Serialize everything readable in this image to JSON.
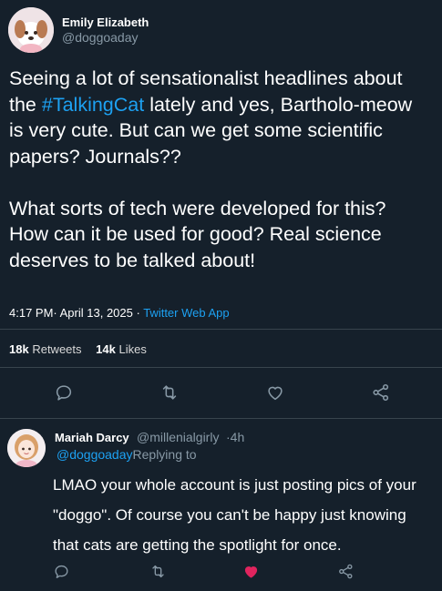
{
  "tweet": {
    "author_name": "Emily Elizabeth",
    "author_handle": "@doggoaday",
    "text_part1": "Seeing a lot of sensationalist headlines about the ",
    "hashtag": "#TalkingCat",
    "text_part2": " lately and yes, Bartholo-meow is very cute. But can we get some scientific papers? Journals??",
    "text_paragraph2": "What sorts of tech were developed for this? How can it be used for good? Real science deserves to be talked about!",
    "time_date": "4:17 PM· April 13, 2025 ·",
    "app": "Twitter Web App",
    "retweets_count": "18k",
    "retweets_label": "Retweets",
    "likes_count": "14k",
    "likes_label": "Likes"
  },
  "reply": {
    "author_name": "Mariah Darcy",
    "author_handle": "@millenialgirly",
    "time": "·4h",
    "replying_mention": "@doggoaday",
    "replying_label": "Replying to",
    "text": "LMAO your whole account is just posting pics of your \"doggo\". Of course you can't be happy just knowing that cats are getting the spotlight for once.",
    "liked": true
  },
  "icons": {
    "reply": "comment-icon",
    "retweet": "retweet-icon",
    "like": "heart-icon",
    "share": "share-icon"
  },
  "colors": {
    "background": "#15202b",
    "accent": "#1da1f2",
    "muted": "#8899a6",
    "liked": "#e0245e"
  }
}
